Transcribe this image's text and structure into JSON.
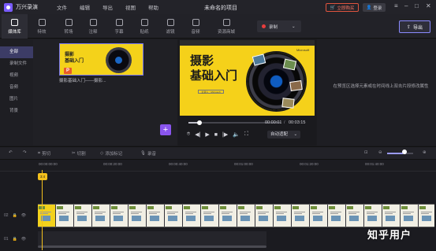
{
  "app": {
    "name": "万兴录演",
    "project_title": "未命名的项目",
    "buy_label": "立即购买",
    "login_label": "登录"
  },
  "menu": [
    "文件",
    "编辑",
    "导出",
    "视图",
    "帮助"
  ],
  "toolbar": {
    "tools": [
      "媒体库",
      "特效",
      "转场",
      "注释",
      "字幕",
      "贴纸",
      "滤镜",
      "音频",
      "资源商城"
    ],
    "active_tool": "媒体库",
    "record_label": "录制",
    "export_label": "导出"
  },
  "sidebar": {
    "items": [
      "全部",
      "录制文件",
      "视频",
      "音频",
      "图片",
      "背景"
    ],
    "active": "全部"
  },
  "media": {
    "thumb_title_line1": "摄影",
    "thumb_title_line2": "基础入门",
    "thumb_badge": "P",
    "caption": "摄影基础入门——摄影..."
  },
  "preview": {
    "slide_title_line1": "摄影",
    "slide_title_line2": "基础入门",
    "slide_subtitle": "主讲人：Microsoft",
    "corner_text": "Microsoft",
    "current_time": "00:00:01",
    "total_time": "00:03:15",
    "progress": 0.12,
    "fit_mode": "自动适配"
  },
  "properties": {
    "hint": "在预览区选择元素或在时间线上双击片段修改属性"
  },
  "timeline_toolbar": {
    "crop_label": "剪切",
    "split_label": "切割",
    "marker_label": "添加标记",
    "voice_label": "录音"
  },
  "ruler": {
    "ticks": [
      "00:00:00:00",
      "00:00:20:00",
      "00:00:40:00",
      "00:01:00:00",
      "00:01:20:00",
      "00:01:40:00"
    ]
  },
  "playhead": {
    "label": "3:4"
  },
  "tracks": {
    "track1_label": "02",
    "track2_label": "01"
  },
  "watermark": "知乎用户"
}
